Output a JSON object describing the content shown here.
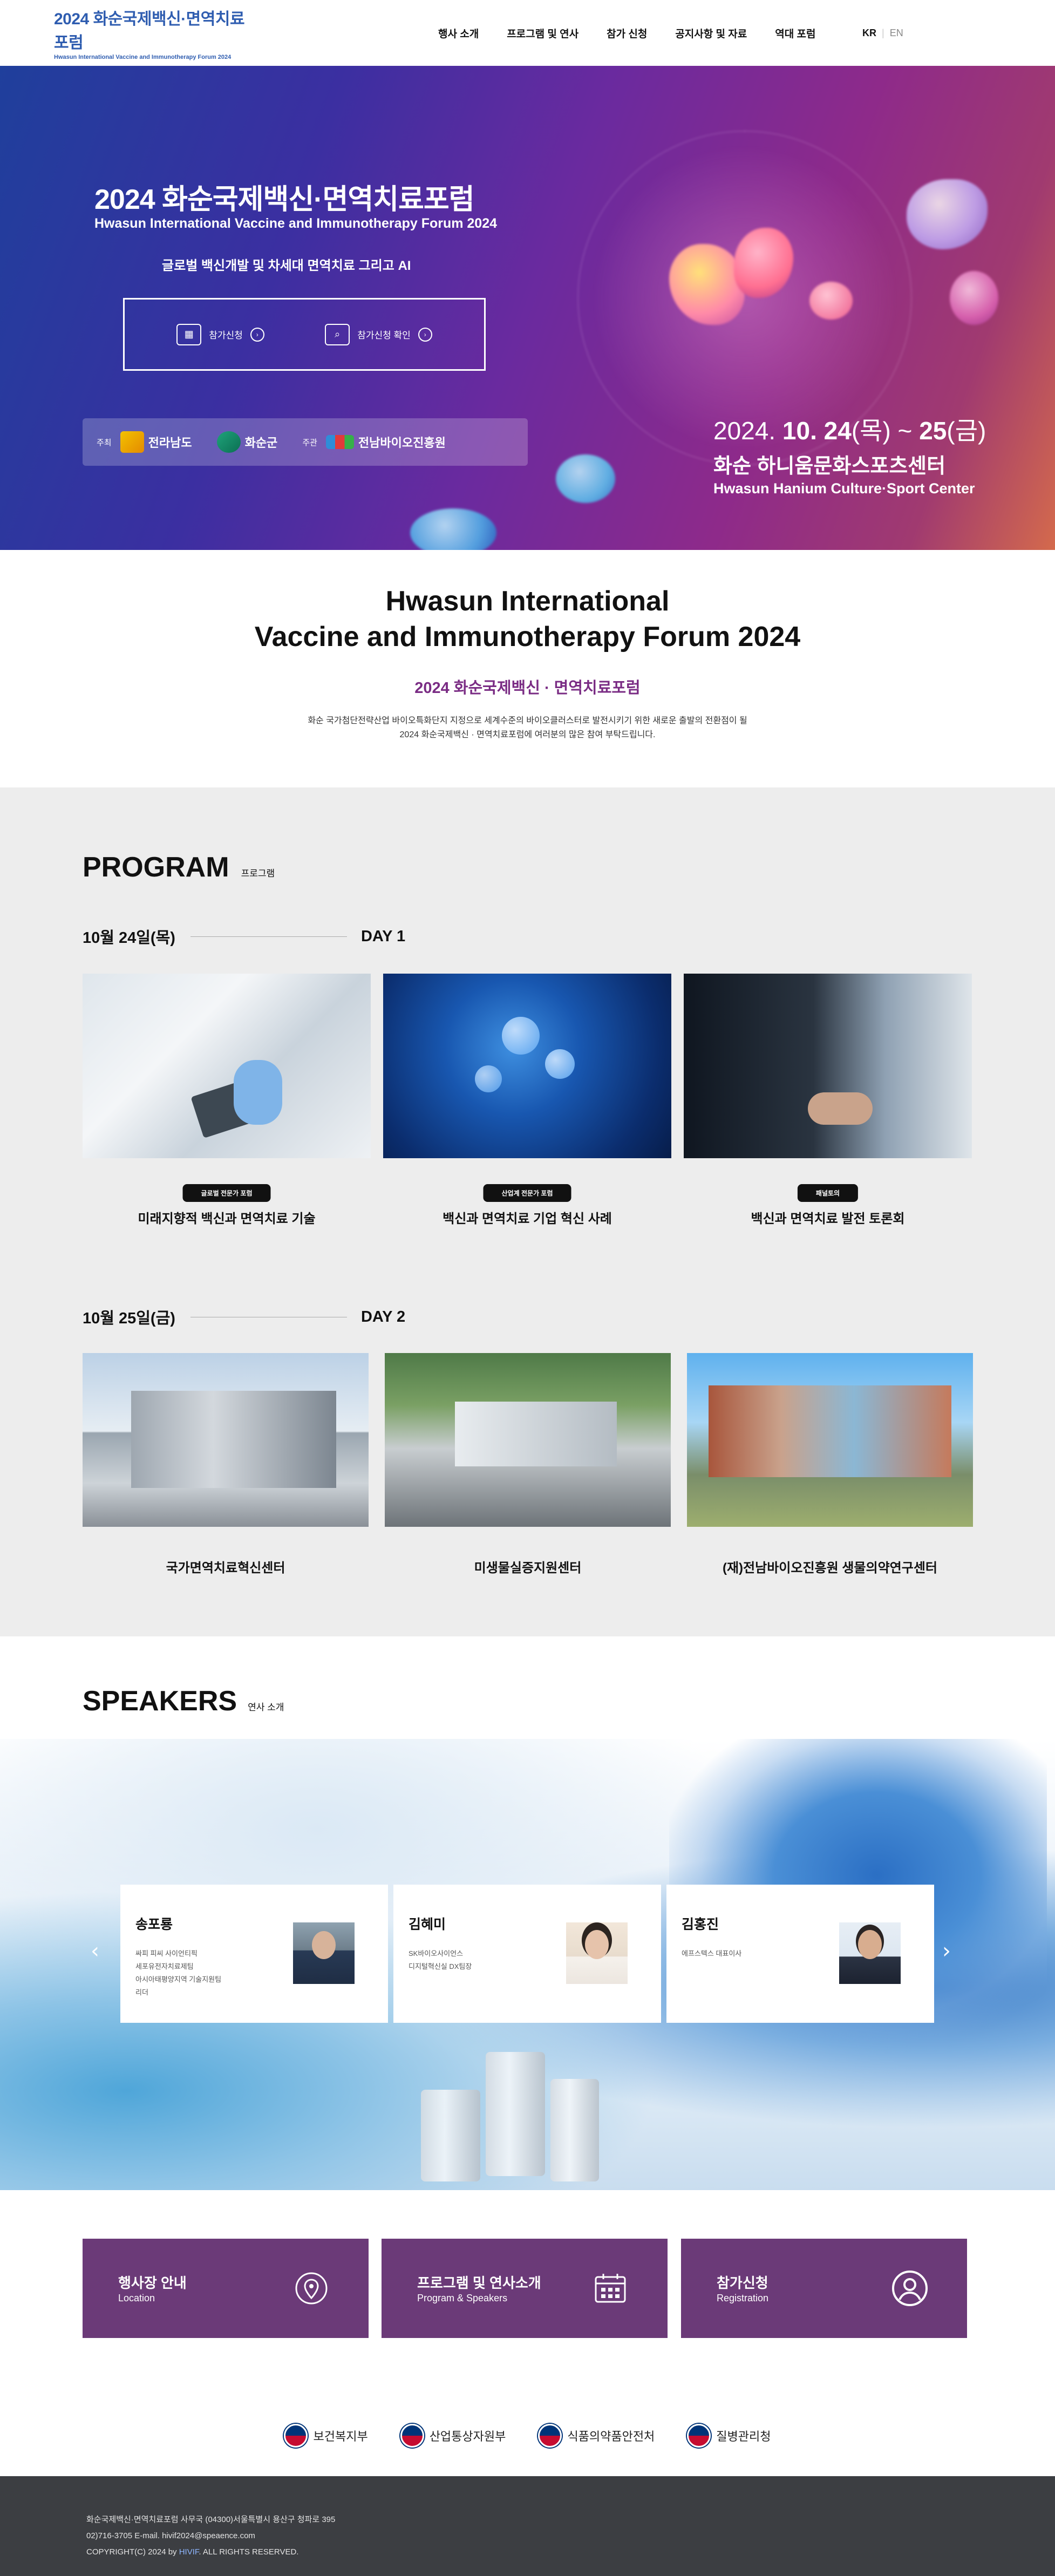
{
  "header": {
    "logo_title": "2024 화순국제백신·면역치료포럼",
    "logo_sub": "Hwasun International Vaccine and Immunotherapy Forum 2024",
    "nav": [
      "행사 소개",
      "프로그램 및 연사",
      "참가 신청",
      "공지사항 및 자료",
      "역대 포럼"
    ],
    "lang_kr": "KR",
    "lang_sep": "|",
    "lang_en": "EN"
  },
  "hero": {
    "title": "2024 화순국제백신·면역치료포럼",
    "subtitle": "Hwasun International Vaccine and Immunotherapy Forum 2024",
    "tagline": "글로벌 백신개발 및 차세대 면역치료 그리고 AI",
    "btn_register": "참가신청",
    "btn_check": "참가신청 확인",
    "host_label": "주최",
    "host1": "전라남도",
    "host2": "화순군",
    "organizer_label": "주관",
    "organizer": "전남바이오진흥원",
    "date_prefix": "2024.",
    "date_main": "10. 24",
    "date_day1": "(목) ~ ",
    "date_end": "25",
    "date_day2": "(금)",
    "venue": "화순 하니움문화스포츠센터",
    "venue_en": "Hwasun Hanium Culture·Sport Center"
  },
  "intro": {
    "title_line1": "Hwasun International",
    "title_line2": "Vaccine and Immunotherapy Forum 2024",
    "subtitle": "2024 화순국제백신 · 면역치료포럼",
    "desc_line1": "화순 국가첨단전략산업 바이오특화단지 지정으로 세계수준의 바이오클러스터로 발전시키기 위한 새로운 출발의 전환점이 될",
    "desc_line2": "2024 화순국제백신 · 면역치료포럼에 여러분의 많은 참여 부탁드립니다."
  },
  "program": {
    "heading": "PROGRAM",
    "heading_sub": "프로그램",
    "day1": {
      "date": "10월 24일(목)",
      "label": "DAY 1",
      "items": [
        {
          "badge": "글로벌 전문가 포럼",
          "title": "미래지향적 백신과 면역치료 기술"
        },
        {
          "badge": "산업계 전문가 포럼",
          "title": "백신과 면역치료 기업 혁신 사례"
        },
        {
          "badge": "패널토의",
          "title": "백신과 면역치료 발전 토론회"
        }
      ]
    },
    "day2": {
      "date": "10월 25일(금)",
      "label": "DAY 2",
      "items": [
        {
          "title": "국가면역치료혁신센터"
        },
        {
          "title": "미생물실증지원센터"
        },
        {
          "title": "(재)전남바이오진흥원 생물의약연구센터"
        }
      ]
    }
  },
  "speakers": {
    "heading": "SPEAKERS",
    "heading_sub": "연사 소개",
    "list": [
      {
        "name": "송포룡",
        "desc1": "싸피 피씨 사이언티픽",
        "desc2": "세포유전자치료제팀",
        "desc3": "아시아태평양지역 기술지원팀",
        "desc4": "리더"
      },
      {
        "name": "김혜미",
        "desc1": "SK바이오사이언스",
        "desc2": "디지털혁신실 DX팀장",
        "desc3": "",
        "desc4": ""
      },
      {
        "name": "김홍진",
        "desc1": "에프스텍스 대표이사",
        "desc2": "",
        "desc3": "",
        "desc4": ""
      }
    ],
    "prev": "‹",
    "next": "›"
  },
  "links": [
    {
      "title": "행사장 안내",
      "sub": "Location"
    },
    {
      "title": "프로그램 및 연사소개",
      "sub": "Program & Speakers"
    },
    {
      "title": "참가신청",
      "sub": "Registration"
    }
  ],
  "partners": [
    "보건복지부",
    "산업통상자원부",
    "식품의약품안전처",
    "질병관리청"
  ],
  "footer": {
    "line1": "화순국제백신·면역치료포럼 사무국 (04300)서울특별시 용산구 청파로 395",
    "line2": "02)716-3705      E-mail. hivif2024@speaence.com",
    "line3_pre": "COPYRIGHT(C) 2024 by ",
    "line3_brand": "HIVIF",
    "line3_post": ". ALL RIGHTS RESERVED."
  },
  "colors": {
    "brand_blue": "#2f5db0",
    "accent_purple": "#7a2c84",
    "link_box": "#6b3a78",
    "footer_bg": "#3c3e42"
  }
}
